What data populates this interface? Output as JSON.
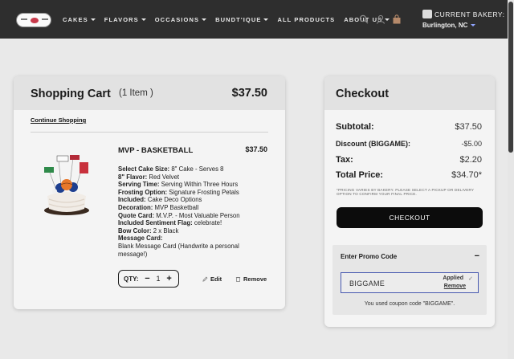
{
  "header": {
    "nav": [
      {
        "label": "CAKES",
        "has_caret": true
      },
      {
        "label": "FLAVORS",
        "has_caret": true
      },
      {
        "label": "OCCASIONS",
        "has_caret": true
      },
      {
        "label": "BUNDT'IQUE",
        "has_caret": true
      },
      {
        "label": "ALL PRODUCTS",
        "has_caret": false
      },
      {
        "label": "ABOUT US",
        "has_caret": true
      }
    ],
    "icons": [
      "search-icon",
      "user-icon",
      "bag-icon"
    ],
    "bakery_label": "CURRENT BAKERY:",
    "bakery_city": "Burlington, NC"
  },
  "cart": {
    "title": "Shopping Cart",
    "count": "(1 Item )",
    "total": "$37.50",
    "continue_label": "Continue Shopping",
    "item": {
      "name": "MVP - BASKETBALL",
      "price": "$37.50",
      "options": [
        {
          "label": "Select Cake Size:",
          "value": "8\" Cake - Serves 8"
        },
        {
          "label": "8\" Flavor:",
          "value": "Red Velvet"
        },
        {
          "label": "Serving Time:",
          "value": "Serving Within Three Hours"
        },
        {
          "label": "Frosting Option:",
          "value": "Signature Frosting Petals"
        },
        {
          "label": "Included:",
          "value": "Cake Deco Options"
        },
        {
          "label": "Decoration:",
          "value": "MVP Basketball"
        },
        {
          "label": "Quote Card:",
          "value": "M.V.P. - Most Valuable Person"
        },
        {
          "label": "Included Sentiment Flag:",
          "value": "celebrate!"
        },
        {
          "label": "Bow Color:",
          "value": "2 x Black"
        },
        {
          "label": "Message Card:",
          "value": ""
        }
      ],
      "message_card": "Blank Message Card (Handwrite a personal message!)",
      "qty_label": "QTY:",
      "qty_minus": "−",
      "qty_value": "1",
      "qty_plus": "+",
      "edit_label": "Edit",
      "remove_label": "Remove"
    }
  },
  "checkout": {
    "title": "Checkout",
    "subtotal_label": "Subtotal:",
    "subtotal": "$37.50",
    "discount_label": "Discount (BIGGAME):",
    "discount": "-$5.00",
    "tax_label": "Tax:",
    "tax": "$2.20",
    "total_label": "Total Price:",
    "total": "$34.70*",
    "fine_print": "*PRICING VARIES BY BAKERY. PLEASE SELECT A PICKUP OR DELIVERY OPTION TO CONFIRM YOUR FINAL PRICE.",
    "button_label": "CHECKOUT",
    "promo": {
      "title": "Enter Promo Code",
      "toggle": "−",
      "code": "BIGGAME",
      "applied": "Applied",
      "remove": "Remove",
      "message": "You used coupon code \"BIGGAME\"."
    }
  }
}
